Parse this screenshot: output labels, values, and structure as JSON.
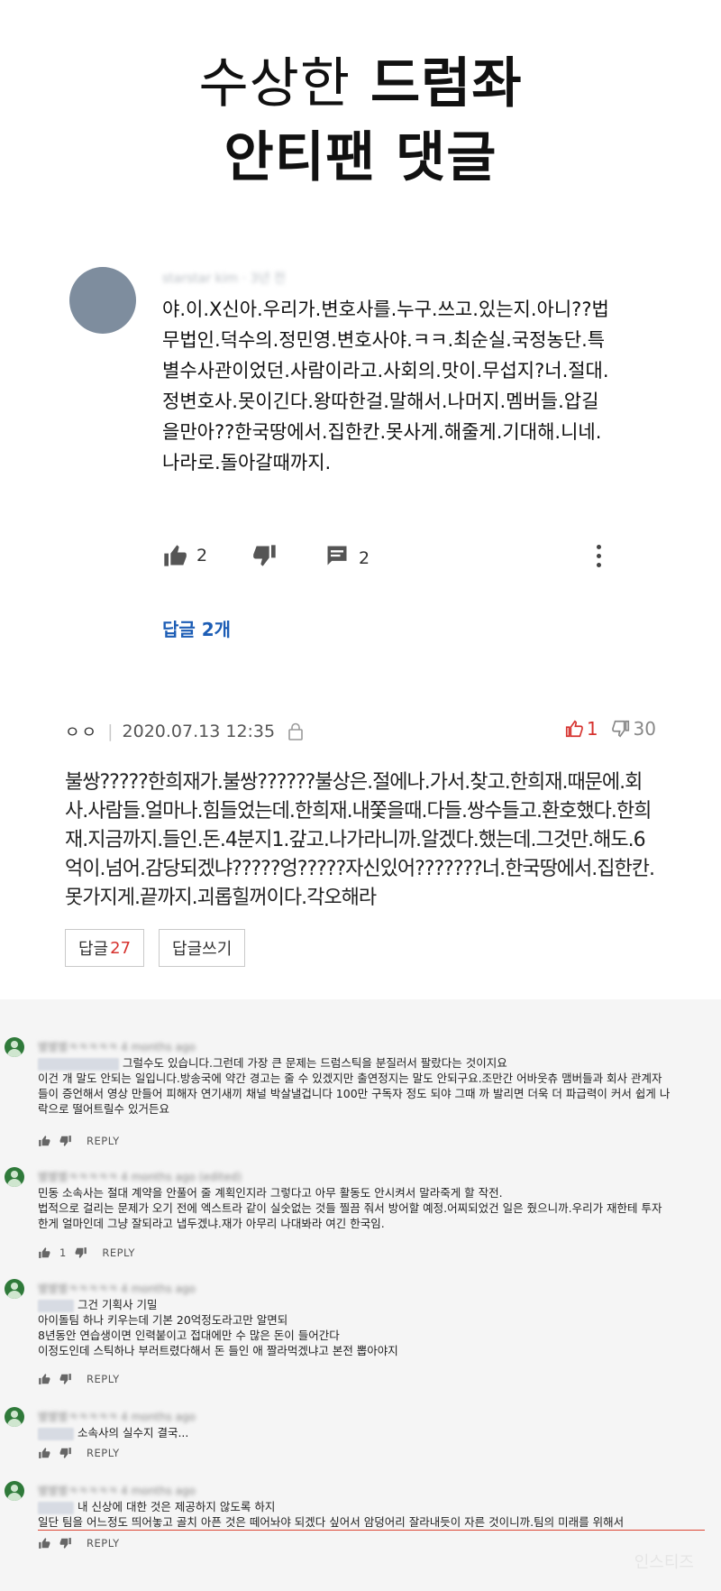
{
  "title": {
    "line1_a": "수상한",
    "line1_b": "드럼좌",
    "line2": "안티팬 댓글"
  },
  "comment1": {
    "author": "starstar kim · 3년 전",
    "text": "야.이.X신아.우리가.변호사를.누구.쓰고.있는지.아니??법무법인.덕수의.정민영.변호사야.ㅋㅋ.최순실.국정농단.특별수사관이었던.사람이라고.사회의.맛이.무섭지?너.절대.정변호사.못이긴다.왕따한걸.말해서.나머지.멤버들.압길을만아??한국땅에서.집한칸.못사게.해줄게.기대해.니네.나라로.돌아갈때까지.",
    "likes": "2",
    "replies_count": "2",
    "replies_link": "답글 2개",
    "icons": [
      "thumb-up-icon",
      "thumb-down-icon",
      "reply-icon",
      "more-vert-icon"
    ]
  },
  "comment2": {
    "user": "ㅇㅇ",
    "date": "2020.07.13 12:35",
    "upvotes": "1",
    "downvotes": "30",
    "text": "불쌍?????한희재가.불쌍??????불상은.절에나.가서.찾고.한희재.때문에.회사.사람들.얼마나.힘들었는데.한희재.내쫓을때.다들.쌍수들고.환호했다.한희재.지금까지.들인.돈.4분지1.갚고.나가라니까.알겠다.했는데.그것만.해도.6억이.넘어.감당되겠냐?????엉?????자신있어???????너.한국땅에서.집한칸.못가지게.끝까지.괴롭힐꺼이다.각오해라",
    "reply_btn": "답글",
    "reply_count": "27",
    "write_btn": "답글쓰기"
  },
  "thread": [
    {
      "name": "별별별ㅋㅋㅋㅋㅋ 4 months ago",
      "lines": [
        "그럴수도 있습니다.그런데 가장 큰 문제는 드럼스틱을 분질러서 팔랐다는 것이지요",
        "이건 개 말도 안되는 일입니다.방송국에 약간 경고는 줄 수 있겠지만 출연정지는 말도 안되구요.조만간 어바웃츄 맴버들과 회사 관계자",
        "들이 증언해서 영상 만들어 피해자 연기새끼 채널 박살낼겁니다 100만 구독자 정도 되야 그때 까 발리면 더욱 더 파급력이 커서 쉽게 나",
        "락으로 떨어트릴수 있거든요"
      ],
      "likes": "",
      "reply": "REPLY"
    },
    {
      "name": "별별별ㅋㅋㅋㅋㅋ 4 months ago (edited)",
      "lines": [
        "민동 소속사는 절대 계약을 안풀어 줄 계획인지라 그렇다고 아무 활동도 안시켜서 말라죽게 할 작전.",
        "법적으로 걸리는 문제가 오기 전에 엑스트라 같이 실숫없는 것들 찔끔 줘서 방어할 예정.어찌되었건 일은 줬으니까.우리가 재한테 투자",
        "한게 얼마인데 그냥 잘되라고 냅두겠냐.재가 아무리 나대봐라 여긴 한국임."
      ],
      "likes": "1",
      "reply": "REPLY"
    },
    {
      "name": "별별별ㅋㅋㅋㅋㅋ 4 months ago",
      "lines": [
        "그건 기획사 기밀",
        "아이돌팀 하나 키우는데 기본 20억정도라고만 알면되",
        "8년동안 연습생이면 인력붙이고 접대에만 수 많은 돈이 들어간다",
        "이정도인데 스틱하나 부러트렸다해서 돈 들인 애 짤라먹겠냐고 본전 뽑아야지"
      ],
      "likes": "",
      "reply": "REPLY"
    },
    {
      "name": "별별별ㅋㅋㅋㅋㅋ 4 months ago",
      "lines": [
        "소속사의 실수지 결국..."
      ],
      "likes": "",
      "reply": "REPLY"
    },
    {
      "name": "별별별ㅋㅋㅋㅋㅋ 4 months ago",
      "lines": [
        "내 신상에 대한 것은 제공하지 않도록 하지",
        "일단 팀을 어느정도 띄어놓고 골치 아픈 것은 떼어놔야 되겠다 싶어서 암덩어리 잘라내듯이 자른 것이니까.팀의 미래를 위해서"
      ],
      "likes": "",
      "reply": "REPLY"
    }
  ],
  "watermark": "인스티즈"
}
